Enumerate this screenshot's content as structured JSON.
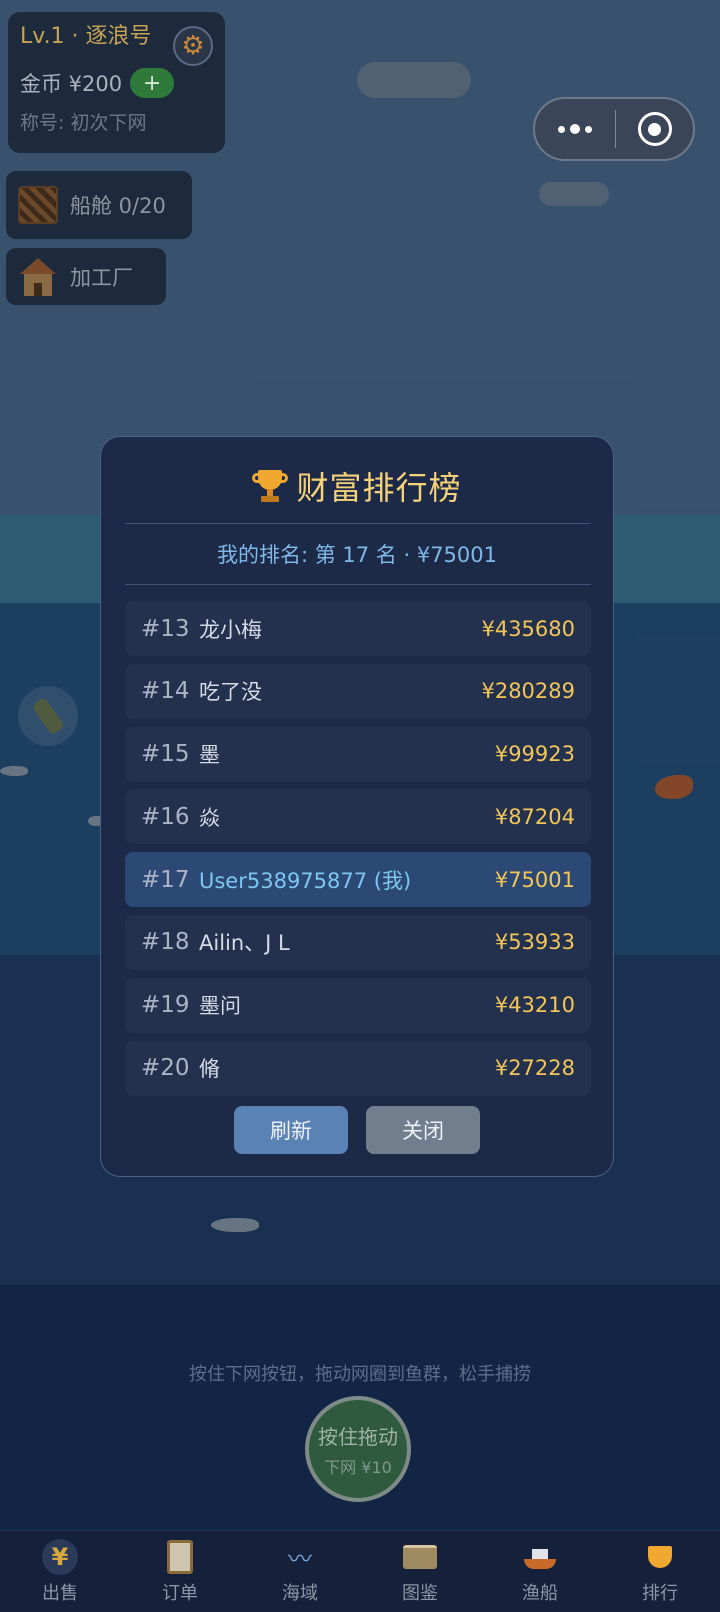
{
  "hud": {
    "level": "Lv.1 · 逐浪号",
    "coins_label": "金币 ¥200",
    "plus": "+",
    "title_line": "称号: 初次下网",
    "cabin": "船舱 0/20",
    "factory": "加工厂"
  },
  "leaderboard": {
    "title": "财富排行榜",
    "my_rank": "我的排名: 第 17 名 · ¥75001",
    "rows": [
      {
        "rank": "#13",
        "name": "龙小梅",
        "money": "¥435680"
      },
      {
        "rank": "#14",
        "name": "吃了没",
        "money": "¥280289"
      },
      {
        "rank": "#15",
        "name": "墨",
        "money": "¥99923"
      },
      {
        "rank": "#16",
        "name": "焱",
        "money": "¥87204"
      },
      {
        "rank": "#17",
        "name": "User538975877 (我)",
        "money": "¥75001"
      },
      {
        "rank": "#18",
        "name": "Ailin、J L",
        "money": "¥53933"
      },
      {
        "rank": "#19",
        "name": "墨问",
        "money": "¥43210"
      },
      {
        "rank": "#20",
        "name": "脩",
        "money": "¥27228"
      }
    ],
    "refresh": "刷新",
    "close": "关闭"
  },
  "cast": {
    "hint": "按住下网按钮，拖动网圈到鱼群，松手捕捞",
    "main": "按住拖动",
    "sub": "下网 ¥10"
  },
  "tabs": [
    "出售",
    "订单",
    "海域",
    "图鉴",
    "渔船",
    "排行"
  ],
  "colors": {
    "accent_gold": "#f3c658",
    "self_row": "#2c4874",
    "refresh_button": "#5a82b4"
  }
}
